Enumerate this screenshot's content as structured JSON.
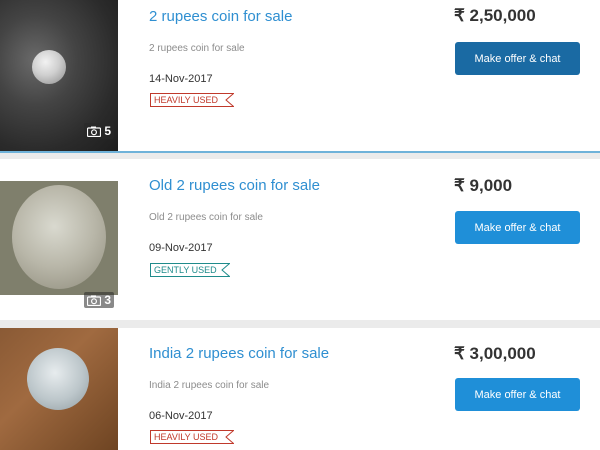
{
  "listings": [
    {
      "title": "2 rupees coin for sale",
      "subtitle": "2 rupees coin for sale",
      "date": "14-Nov-2017",
      "condition": "HEAVILY USED",
      "price": "₹ 2,50,000",
      "button": "Make offer & chat",
      "photo_count": "5"
    },
    {
      "title": "Old 2 rupees coin for sale",
      "subtitle": "Old 2 rupees coin for sale",
      "date": "09-Nov-2017",
      "condition": "GENTLY USED",
      "price": "₹ 9,000",
      "button": "Make offer & chat",
      "photo_count": "3"
    },
    {
      "title": "India 2 rupees coin for sale",
      "subtitle": "India 2 rupees coin for sale",
      "date": "06-Nov-2017",
      "condition": "HEAVILY USED",
      "price": "₹ 3,00,000",
      "button": "Make offer & chat"
    }
  ],
  "colors": {
    "title": "#2f8fd1",
    "button_primary": "#1f8fd8",
    "button_active": "#1a6aa3",
    "badge_heavily_used": "#c0392b",
    "badge_gently_used": "#1f8b8b"
  },
  "icons": {
    "photo_count": "camera-icon"
  }
}
